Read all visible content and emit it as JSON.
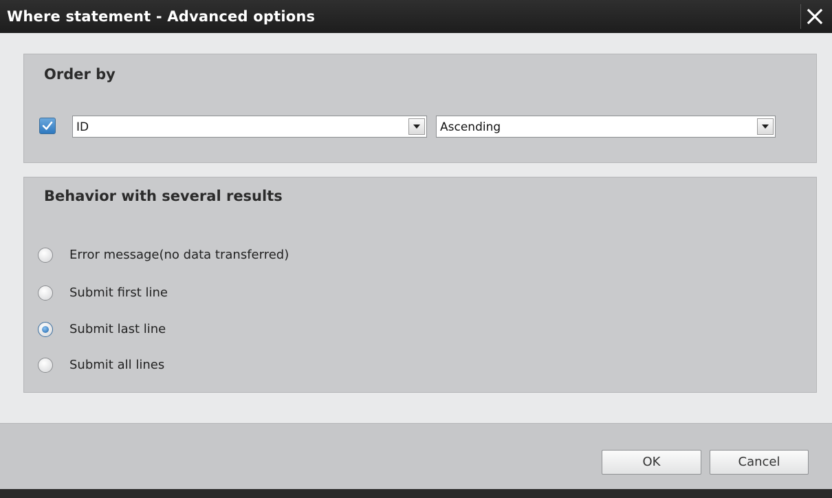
{
  "dialog": {
    "title": "Where statement - Advanced options"
  },
  "order_by": {
    "title": "Order by",
    "enabled": true,
    "field_value": "ID",
    "direction_value": "Ascending"
  },
  "behavior": {
    "title": "Behavior with several results",
    "options": [
      {
        "label": "Error message(no data transferred)",
        "checked": false
      },
      {
        "label": "Submit first line",
        "checked": false
      },
      {
        "label": "Submit last line",
        "checked": true
      },
      {
        "label": "Submit all lines",
        "checked": false
      }
    ]
  },
  "buttons": {
    "ok_label": "OK",
    "cancel_label": "Cancel"
  },
  "icons": {
    "close": "close-icon",
    "dropdown": "chevron-down-icon",
    "check": "checkmark-icon"
  },
  "colors": {
    "titlebar": "#1d1d1d",
    "accent": "#2e79c0",
    "group_bg": "#c9cacc"
  }
}
